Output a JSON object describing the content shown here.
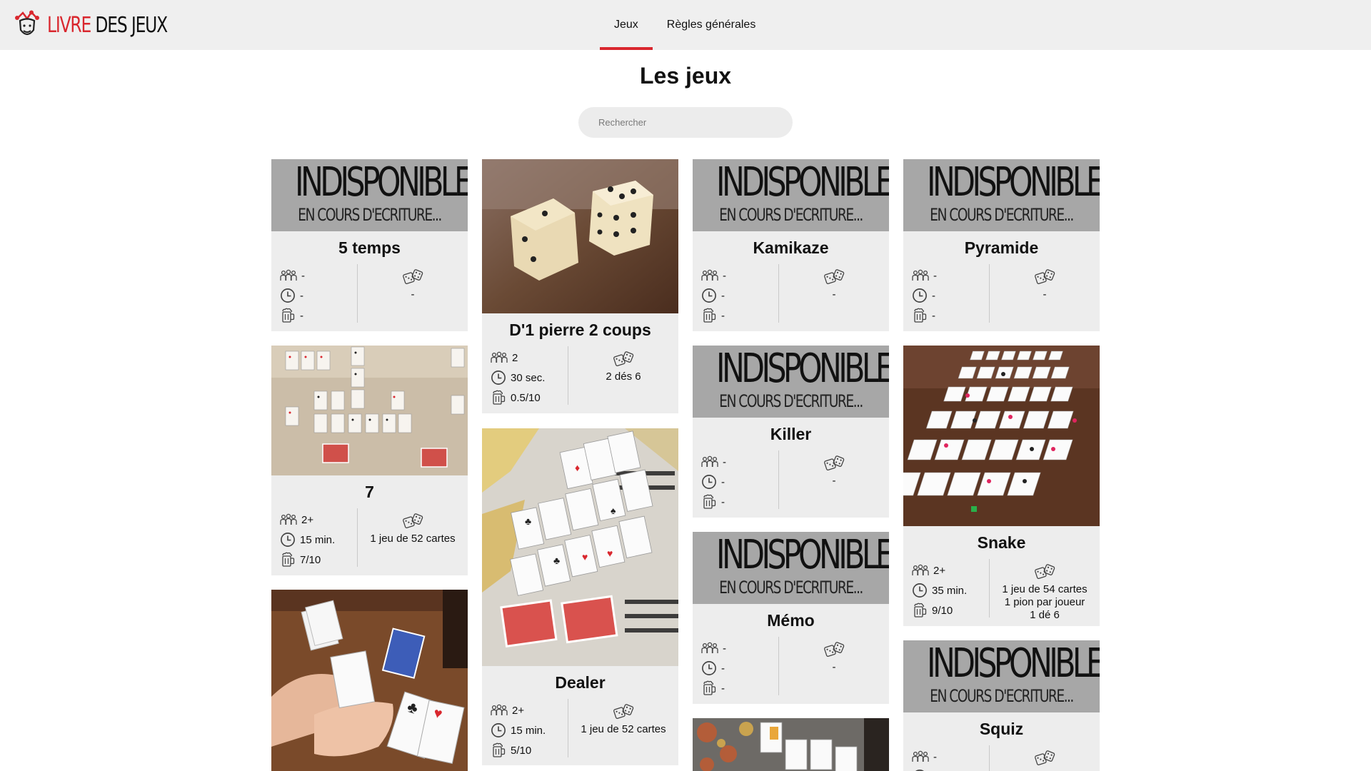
{
  "header": {
    "logo_word1": "LIVRE",
    "logo_word2": "DES JEUX",
    "nav": [
      {
        "label": "Jeux",
        "active": true
      },
      {
        "label": "Règles générales",
        "active": false
      }
    ]
  },
  "page_title": "Les jeux",
  "search": {
    "placeholder": "Rechercher",
    "value": ""
  },
  "banner": {
    "line1": "INDISPONIBLE",
    "line2": "EN COURS D'ECRITURE..."
  },
  "colors": {
    "accent": "#d9272e",
    "card_bg": "#ededed",
    "banner_bg": "#a7a7a7",
    "header_bg": "#efefef"
  },
  "icons": {
    "players": "people-icon",
    "time": "clock-icon",
    "difficulty": "beer-mug-icon",
    "material": "dice-icon"
  },
  "games": [
    {
      "title": "5 temps",
      "players": "-",
      "time": "-",
      "difficulty": "-",
      "material": [
        "-"
      ],
      "image": "unavailable-banner"
    },
    {
      "title": "7",
      "players": "2+",
      "time": "15 min.",
      "difficulty": "7/10",
      "material": [
        "1 jeu de 52 cartes"
      ],
      "image": "cards-photo"
    },
    {
      "title": "",
      "players": "",
      "time": "",
      "difficulty": "",
      "material": [],
      "image": "hands-cards-photo"
    },
    {
      "title": "D'1 pierre 2 coups",
      "players": "2",
      "time": "30 sec.",
      "difficulty": "0.5/10",
      "material": [
        "2 dés 6"
      ],
      "image": "dice-photo"
    },
    {
      "title": "Dealer",
      "players": "2+",
      "time": "15 min.",
      "difficulty": "5/10",
      "material": [
        "1 jeu de 52 cartes"
      ],
      "image": "cards-table-photo"
    },
    {
      "title": "Kamikaze",
      "players": "-",
      "time": "-",
      "difficulty": "-",
      "material": [
        "-"
      ],
      "image": "unavailable-banner"
    },
    {
      "title": "Killer",
      "players": "-",
      "time": "-",
      "difficulty": "-",
      "material": [
        "-"
      ],
      "image": "unavailable-banner"
    },
    {
      "title": "Mémo",
      "players": "-",
      "time": "-",
      "difficulty": "-",
      "material": [
        "-"
      ],
      "image": "unavailable-banner"
    },
    {
      "title": "",
      "players": "",
      "time": "",
      "difficulty": "",
      "material": [],
      "image": "cards-photo"
    },
    {
      "title": "Pyramide",
      "players": "-",
      "time": "-",
      "difficulty": "-",
      "material": [
        "-"
      ],
      "image": "unavailable-banner"
    },
    {
      "title": "Snake",
      "players": "2+",
      "time": "35 min.",
      "difficulty": "9/10",
      "material": [
        "1 jeu de 54 cartes",
        "1 pion par joueur",
        "1 dé 6"
      ],
      "image": "cards-grid-photo"
    },
    {
      "title": "Squiz",
      "players": "-",
      "time": "",
      "difficulty": "",
      "material": [],
      "image": "unavailable-banner"
    }
  ]
}
